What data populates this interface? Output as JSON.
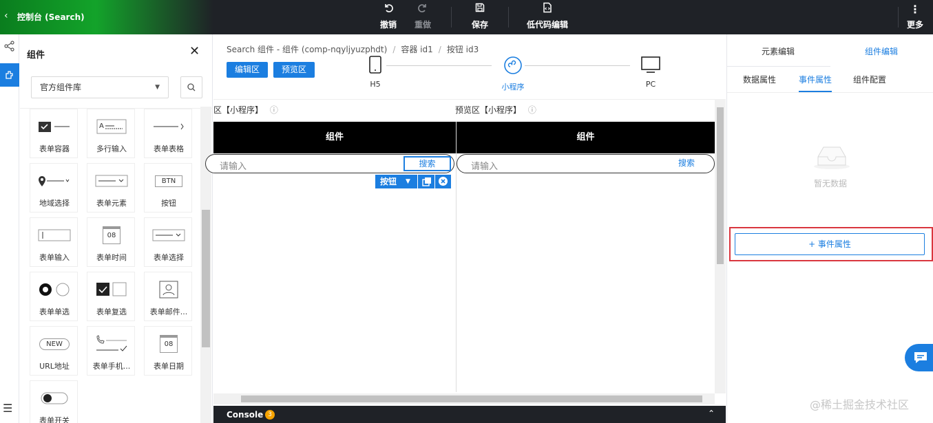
{
  "topbar": {
    "back_icon": "chevron-left-icon",
    "title": "控制台 (Search)",
    "undo_label": "撤销",
    "redo_label": "重做",
    "save_label": "保存",
    "lowcode_label": "低代码编辑",
    "more_label": "更多"
  },
  "panel": {
    "title": "组件",
    "library_select": "官方组件库",
    "items": [
      {
        "label": "表单容器"
      },
      {
        "label": "多行输入"
      },
      {
        "label": "表单表格"
      },
      {
        "label": "地域选择"
      },
      {
        "label": "表单元素"
      },
      {
        "label": "按钮",
        "preview": "BTN"
      },
      {
        "label": "表单输入"
      },
      {
        "label": "表单时间",
        "preview": "08"
      },
      {
        "label": "表单选择"
      },
      {
        "label": "表单单选"
      },
      {
        "label": "表单复选"
      },
      {
        "label": "表单邮件..."
      },
      {
        "label": "URL地址",
        "preview": "NEW"
      },
      {
        "label": "表单手机..."
      },
      {
        "label": "表单日期",
        "preview": "08"
      },
      {
        "label": "表单开关"
      }
    ]
  },
  "center": {
    "breadcrumb": [
      "Search 组件 - 组件 (comp-nqyljyuzphdt)",
      "容器 id1",
      "按钮 id3"
    ],
    "edit_area_button": "编辑区",
    "preview_area_button": "预览区",
    "devices": [
      {
        "label": "H5",
        "icon": "mobile-icon"
      },
      {
        "label": "小程序",
        "icon": "miniprogram-icon",
        "active": true
      },
      {
        "label": "PC",
        "icon": "monitor-icon"
      }
    ],
    "edit_panel_title": "区【小程序】",
    "preview_panel_title": "预览区【小程序】",
    "phone_header": "组件",
    "search_placeholder": "请输入",
    "search_button": "搜索",
    "toolbar_label": "按钮",
    "console_label": "Console",
    "console_badge": "3"
  },
  "right": {
    "tab_element": "元素编辑",
    "tab_component": "组件编辑",
    "sub_tabs": [
      "数据属性",
      "事件属性",
      "组件配置"
    ],
    "empty_text": "暂无数据",
    "add_event_button": "+ 事件属性"
  },
  "watermark": "@稀土掘金技术社区",
  "colors": {
    "accent": "#1b7ee0",
    "topbar": "#1f2227",
    "brand_green": "#13a32a",
    "highlight_red": "#d9363e"
  }
}
